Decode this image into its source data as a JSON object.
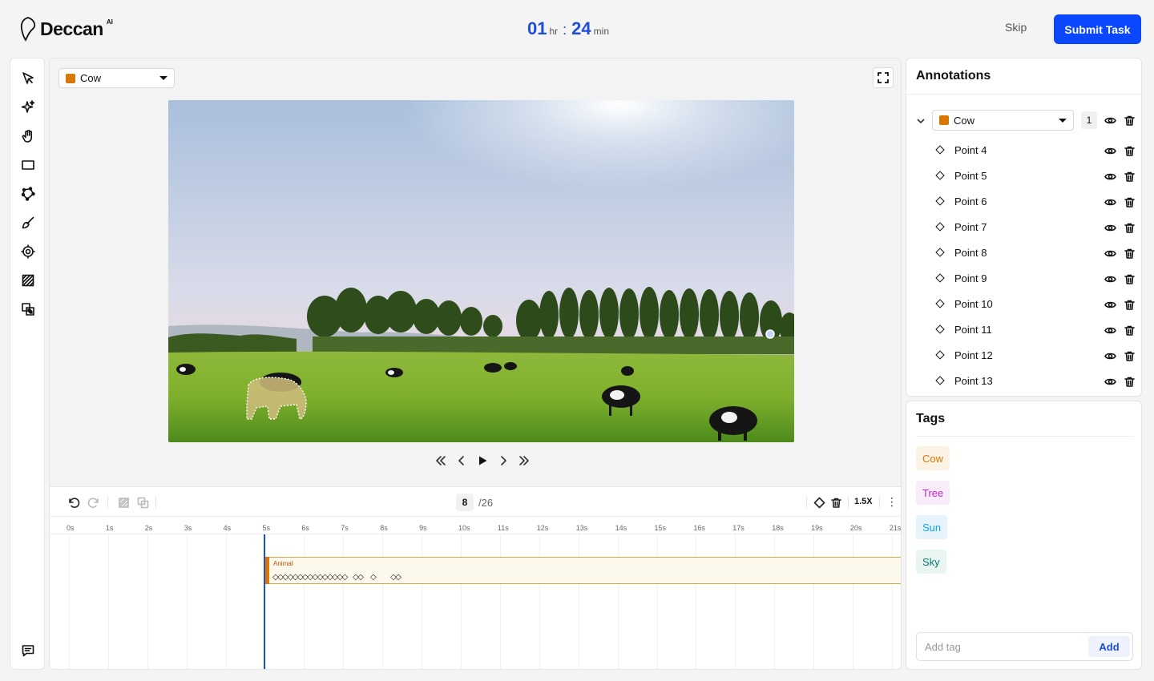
{
  "header": {
    "brand": "Deccan",
    "brand_sup": "AI",
    "timer": {
      "hours": "01",
      "hours_unit": "hr",
      "separator": ":",
      "minutes": "24",
      "minutes_unit": "min"
    },
    "skip_label": "Skip",
    "submit_label": "Submit Task"
  },
  "toolbar": {
    "tools": [
      "select-pointer",
      "magic-wand",
      "pan-hand",
      "rectangle",
      "polygon",
      "brush",
      "keypoint-target",
      "hatch-fill",
      "copy-layers"
    ],
    "bottom": "comments"
  },
  "canvas": {
    "class_select": {
      "label": "Cow",
      "color": "#d97706"
    }
  },
  "timeline": {
    "current_frame": "8",
    "total_frames": "/26",
    "speed": "1.5X",
    "ticks": [
      "0s",
      "1s",
      "2s",
      "3s",
      "4s",
      "5s",
      "6s",
      "7s",
      "8s",
      "9s",
      "10s",
      "11s",
      "12s",
      "13s",
      "14s",
      "15s",
      "16s",
      "17s",
      "18s",
      "19s",
      "20s",
      "21s"
    ],
    "track_label": "Animal",
    "keyframes_main": "◇◇◇◇◇◇◇◇◇◇◇◇◇◇◇",
    "keyframes_a": "◇◇",
    "keyframes_b": "◇",
    "keyframes_c": "◇◇"
  },
  "annotations": {
    "title": "Annotations",
    "group": {
      "label": "Cow",
      "color": "#d97706",
      "count": "1"
    },
    "points": [
      "Point 4",
      "Point 5",
      "Point 6",
      "Point 7",
      "Point 8",
      "Point 9",
      "Point 10",
      "Point 11",
      "Point 12",
      "Point 13"
    ]
  },
  "tags": {
    "title": "Tags",
    "items": [
      {
        "label": "Cow",
        "color": "#d97706",
        "bg": "#fdf3e4"
      },
      {
        "label": "Tree",
        "color": "#c026d3",
        "bg": "#f8ecfa"
      },
      {
        "label": "Sun",
        "color": "#0ea5e9",
        "bg": "#e7f4fb"
      },
      {
        "label": "Sky",
        "color": "#0f766e",
        "bg": "#e9f5f1"
      }
    ],
    "add_placeholder": "Add tag",
    "add_label": "Add"
  }
}
